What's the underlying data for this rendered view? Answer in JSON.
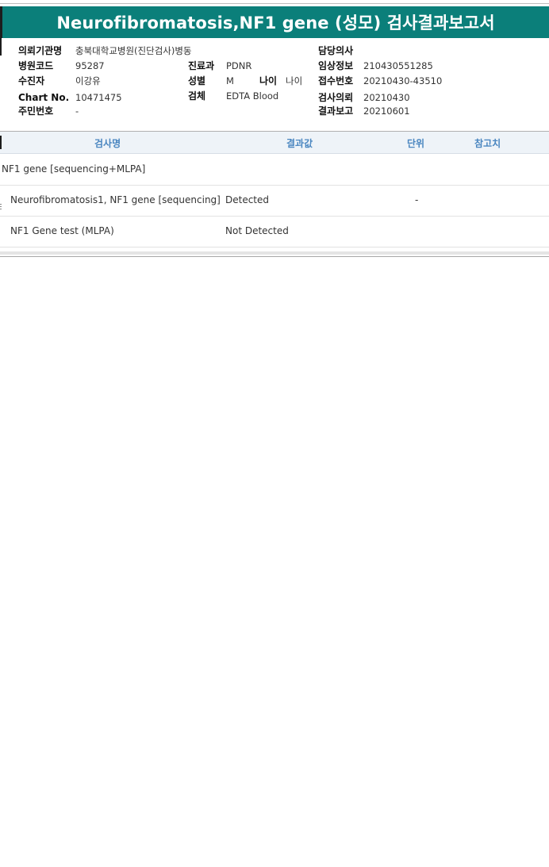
{
  "report": {
    "title": "Neurofibromatosis,NF1 gene (성모) 검사결과보고서"
  },
  "info": {
    "institution_label": "의뢰기관명",
    "institution_value": "충북대학교병원(진단검사)병동",
    "doctor_label": "담당의사",
    "hospital_code_label": "병원코드",
    "hospital_code_value": "95287",
    "department_label": "진료과",
    "department_value": "PDNR",
    "clinical_info_label": "임상정보",
    "clinical_info_value": "210430551285",
    "patient_label": "수진자",
    "patient_value": "이강유",
    "sex_label": "성별",
    "sex_value": "M",
    "age_label": "나이",
    "age_value": "나이",
    "receipt_no_label": "접수번호",
    "receipt_no_value": "20210430-43510",
    "chart_no_label": "Chart No.",
    "chart_no_value": "10471475",
    "specimen_label": "검체",
    "specimen_value": "EDTA Blood",
    "request_date_label": "검사의뢰",
    "request_date_value": "20210430",
    "resident_no_label": "주민번호",
    "resident_no_value": "-",
    "report_date_label": "결과보고",
    "report_date_value": "20210601"
  },
  "table": {
    "headers": [
      "검사명",
      "결과값",
      "단위",
      "참고치"
    ],
    "rows": [
      {
        "name": "NF1 gene [sequencing+MLPA]",
        "result": "",
        "unit": "",
        "reference": ""
      },
      {
        "name": "Neurofibromatosis1, NF1 gene [sequencing]",
        "result": "Detected",
        "unit": "-",
        "reference": ""
      },
      {
        "name": "NF1 Gene test (MLPA)",
        "result": "Not Detected",
        "unit": "",
        "reference": ""
      }
    ]
  },
  "colors": {
    "title_bg": "#0b7f7a",
    "header_text": "#4a86c0",
    "header_bg": "#eef3f8"
  }
}
